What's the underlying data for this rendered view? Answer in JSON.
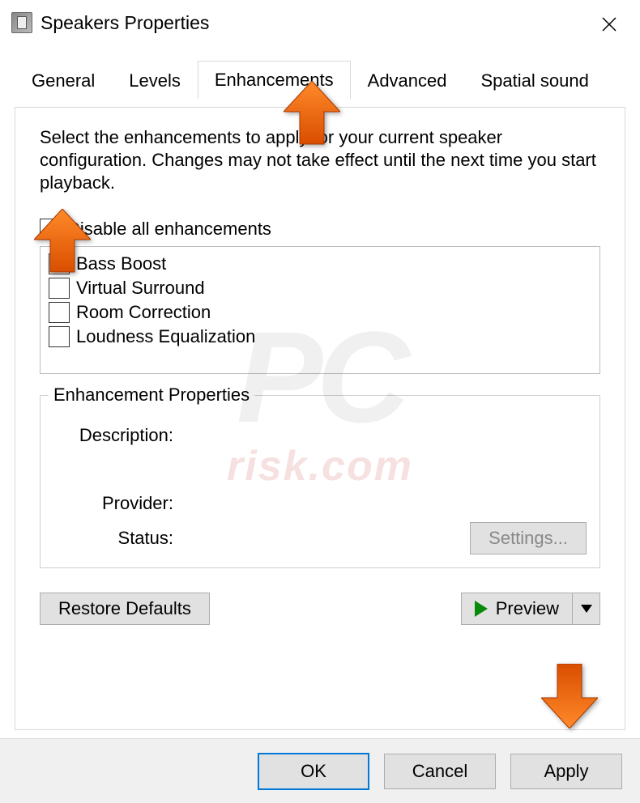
{
  "window": {
    "title": "Speakers Properties"
  },
  "tabs": {
    "general": "General",
    "levels": "Levels",
    "enhancements": "Enhancements",
    "advanced": "Advanced",
    "spatial": "Spatial sound",
    "active": "enhancements"
  },
  "content": {
    "description": "Select the enhancements to apply for your current speaker configuration. Changes may not take effect until the next time you start playback.",
    "disable_all_label": "Disable all enhancements",
    "disable_all_checked": true,
    "enhancements": [
      {
        "label": "Bass Boost",
        "checked": false
      },
      {
        "label": "Virtual Surround",
        "checked": false
      },
      {
        "label": "Room Correction",
        "checked": false
      },
      {
        "label": "Loudness Equalization",
        "checked": false
      }
    ],
    "group_title": "Enhancement Properties",
    "labels": {
      "description": "Description:",
      "provider": "Provider:",
      "status": "Status:"
    },
    "settings_button": "Settings...",
    "restore_defaults": "Restore Defaults",
    "preview": "Preview"
  },
  "footer": {
    "ok": "OK",
    "cancel": "Cancel",
    "apply": "Apply"
  },
  "watermark": {
    "main": "PC",
    "sub": "risk.com"
  }
}
